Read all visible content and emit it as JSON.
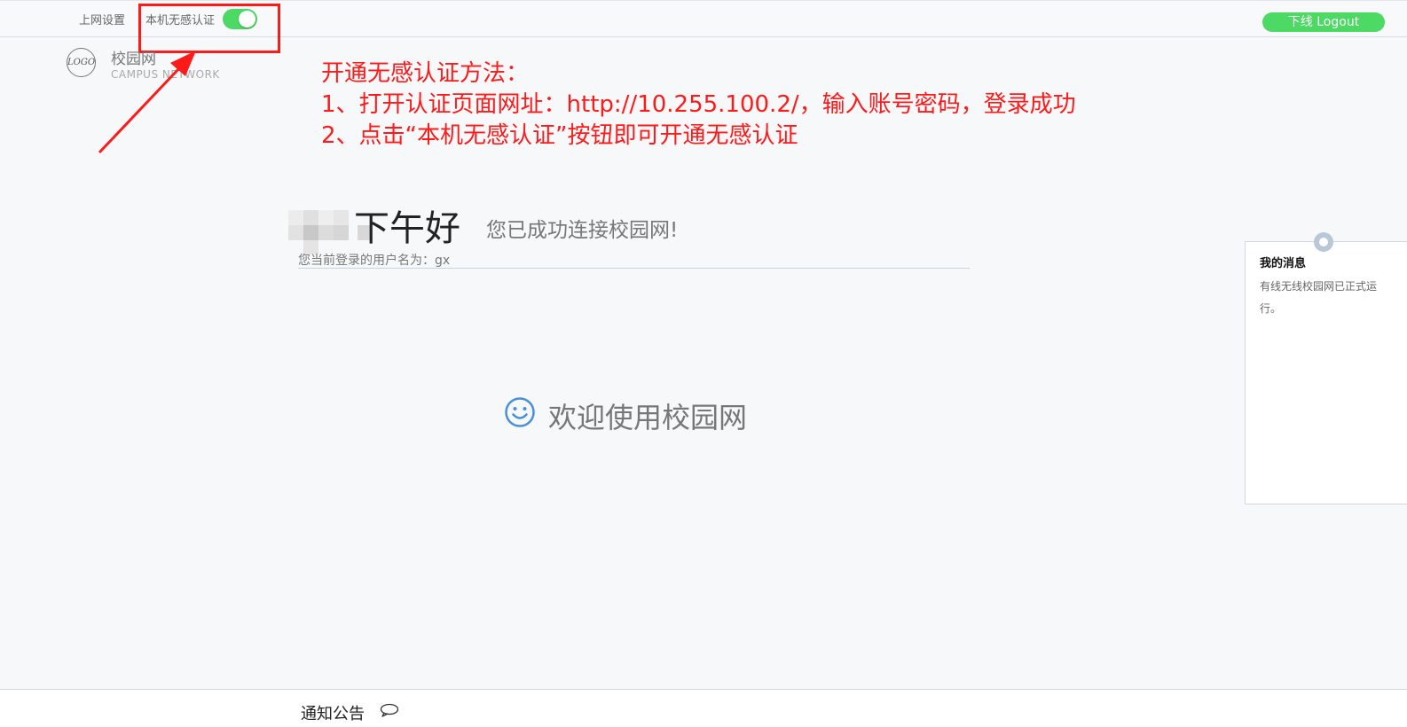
{
  "header": {
    "settings_label": "上网设置",
    "seamless_label": "本机无感认证",
    "seamless_toggle_on": true,
    "logout_label": "下线 Logout"
  },
  "brand": {
    "logo_text": "LOGO",
    "title": "校园网",
    "subtitle": "CAMPUS NETWORK"
  },
  "annotation": {
    "title": "开通无感认证方法：",
    "step1": "1、打开认证页面网址：http://10.255.100.2/，输入账号密码，登录成功",
    "step2": "2、点击“本机无感认证”按钮即可开通无感认证",
    "color": "#ff1a1a"
  },
  "main": {
    "greeting": "下午好",
    "connected_text": "您已成功连接校园网!",
    "username_line": "您当前登录的用户名为：gx",
    "welcome_text": "欢迎使用校园网"
  },
  "messages": {
    "title": "我的消息",
    "body": "有线无线校园网已正式运行。"
  },
  "footer": {
    "notice_label": "通知公告"
  },
  "colors": {
    "accent_green": "#4cd964",
    "page_bg": "#f6f8fa",
    "icon_blue": "#4a90d9"
  },
  "icons": {
    "smile": "smile-icon",
    "chat": "chat-bubble-icon",
    "arrow": "red-arrow-annotation"
  }
}
